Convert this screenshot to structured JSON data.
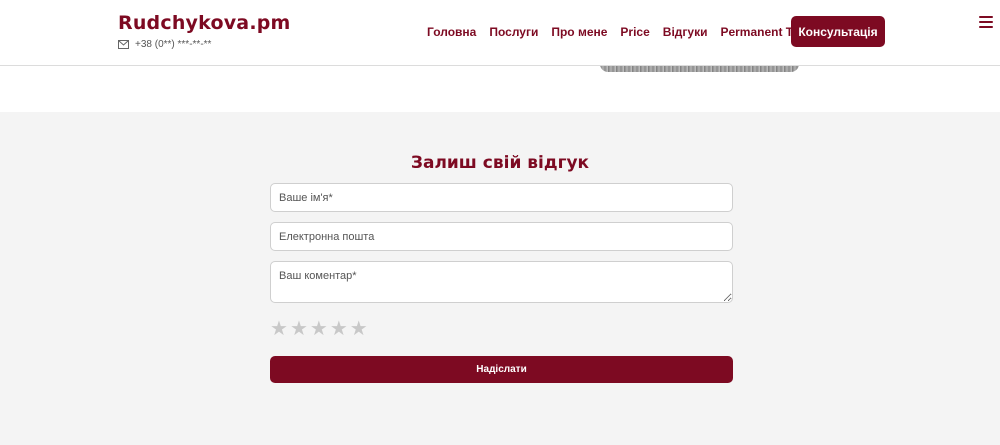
{
  "header": {
    "logo": "Rudchykova.pm",
    "phone": "+38 (0**) ***-**-**",
    "nav": [
      "Головна",
      "Послуги",
      "Про мене",
      "Price",
      "Відгуки",
      "Permanent Truths"
    ],
    "cta_label": "Консультація"
  },
  "form": {
    "title": "Залиш свій відгук",
    "name_placeholder": "Ваше ім'я*",
    "email_placeholder": "Електронна пошта",
    "comment_placeholder": "Ваш коментар*",
    "rating_max": 5,
    "rating_value": 0,
    "star_glyph": "★",
    "submit_label": "Надіслати"
  },
  "colors": {
    "accent": "#7d0a22",
    "section_bg": "#f4f4f4",
    "star_inactive": "#c8c8c8"
  }
}
